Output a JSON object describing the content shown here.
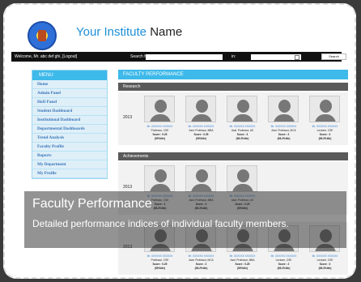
{
  "header": {
    "title_accent": "Your Institute",
    "title_rest": "Name"
  },
  "topbar": {
    "welcome": "Welcome, Mr. abc def ghi, [Logout]",
    "search_label": "Search for:",
    "search_placeholder": "",
    "in_label": "in:",
    "search_button": "Search"
  },
  "menu": {
    "heading": "MENU",
    "items": [
      "Home",
      "Admin Panel",
      "HoD Panel",
      "Student Dashboard",
      "Institutional Dashboard",
      "Departmental Dashboards",
      "Trend Analysis",
      "Faculty Profile",
      "Reports",
      "My Department",
      "My Profile"
    ]
  },
  "main": {
    "heading": "FACULTY PERFORMANCE",
    "sections": {
      "research": "Research",
      "achievements": "Achievements"
    },
    "year": "2013",
    "research_cards": [
      {
        "name": "Mr. XXXXXX XXXXXX",
        "designation": "Professor, CSE",
        "score": "Score : 0.25",
        "percentile": "(50%tile)"
      },
      {
        "name": "Mr. XXXXXX XXXXXX",
        "designation": "Asst. Professor, MBA",
        "score": "Score : 0.25",
        "percentile": "(50%tile)"
      },
      {
        "name": "Mr. XXXXXX XXXXXX",
        "designation": "Asst. Professor, AS",
        "score": "Score : 3",
        "percentile": "(98.3%tile)"
      },
      {
        "name": "Mr. XXXXXX XXXXXX",
        "designation": "Asst. Professor, MCA",
        "score": "Score : 2",
        "percentile": "(98.2%tile)"
      },
      {
        "name": "Mr. XXXXXX XXXXXX",
        "designation": "Lecturer, CSE",
        "score": "Score : 3",
        "percentile": "(98.3%tile)"
      }
    ],
    "achievement_cards": [
      {
        "name": "Mr. XXXXXX XXXXXX",
        "designation": "Professor, CSE",
        "score": "Score : 2",
        "percentile": "(98.2%tile)"
      },
      {
        "name": "Mr. XXXXXX XXXXXX",
        "designation": "Asst. Professor, MBA",
        "score": "Score : 3",
        "percentile": "(98.3%tile)"
      },
      {
        "name": "Mr. XXXXXX XXXXXX",
        "designation": "Asst. Professor, AS",
        "score": "Score : 0.25",
        "percentile": "(50%tile)"
      }
    ],
    "third_cards": [
      {
        "name": "Mr. XXXXXX XXXXXX",
        "designation": "Professor, CSE",
        "score": "Score : 0.25",
        "percentile": "(50%tile)"
      },
      {
        "name": "Mr. XXXXXX XXXXXX",
        "designation": "Asst. Professor, MCA",
        "score": "Score : 2",
        "percentile": "(98.2%tile)"
      },
      {
        "name": "Mr. XXXXXX XXXXXX",
        "designation": "Asst. Professor, MBA",
        "score": "Score : 0.25",
        "percentile": "(50%tile)"
      },
      {
        "name": "Mr. XXXXXX XXXXXX",
        "designation": "Lecturer, CSE",
        "score": "Score : 2",
        "percentile": "(98.2%tile)"
      },
      {
        "name": "Mr. XXXXXX XXXXXX",
        "designation": "Lecturer, CSE",
        "score": "Score : 3",
        "percentile": "(98.3%tile)"
      }
    ]
  },
  "overlay": {
    "title": "Faculty Performance",
    "description": "Detailed performance indices of individual faculty members."
  }
}
